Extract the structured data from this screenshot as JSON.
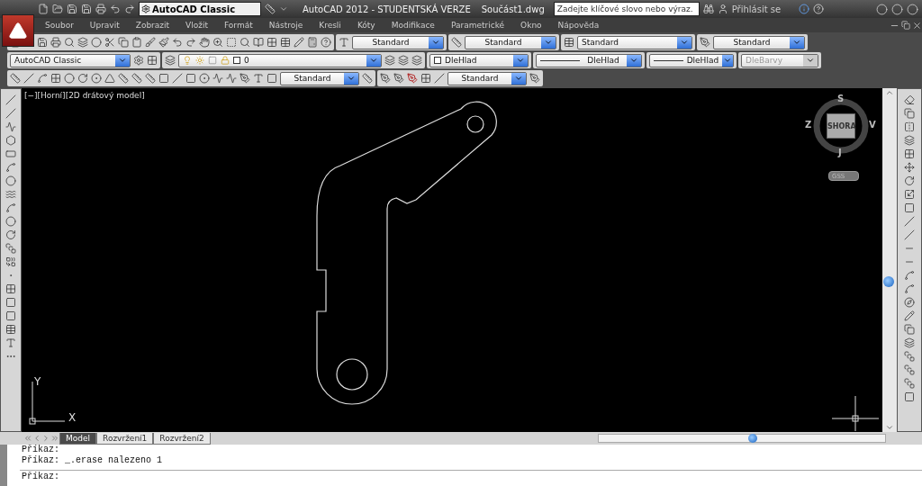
{
  "title_bar": {
    "workspace": "AutoCAD Classic",
    "title": "AutoCAD 2012 - STUDENTSKÁ VERZE",
    "file": "Součást1.dwg",
    "search": {
      "placeholder": "Zadejte klíčové slovo nebo výraz."
    },
    "sign_in": "Přihlásit se"
  },
  "menu": [
    "Soubor",
    "Upravit",
    "Zobrazit",
    "Vložit",
    "Formát",
    "Nástroje",
    "Kresli",
    "Kóty",
    "Modifikace",
    "Parametrické",
    "Okno",
    "Nápověda"
  ],
  "styles_toolbar": [
    {
      "value": "Standard"
    },
    {
      "value": "Standard"
    },
    {
      "value": "Standard"
    },
    {
      "value": "Standard"
    }
  ],
  "properties_toolbar": {
    "workspace": "AutoCAD Classic",
    "layer": "0",
    "color_setting": "DleHlad",
    "linetype": "DleHlad",
    "lineweight": "DleHlad",
    "plot_style": {
      "value": "DleBarvy",
      "disabled": true
    }
  },
  "dimension_toolbar": {
    "dim_style": "Standard",
    "multileader_style": "Standard"
  },
  "viewport": {
    "controls": [
      "[−]",
      "[Horní]",
      "[2D drátový model]"
    ]
  },
  "view_cube": {
    "top": "SHORA",
    "north": "S",
    "east": "V",
    "south": "J",
    "west": "Z",
    "ucs_menu": "GSS"
  },
  "ucs": {
    "x": "X",
    "y": "Y"
  },
  "layout_tabs": [
    {
      "label": "Model",
      "selected": true
    },
    {
      "label": "Rozvržení1",
      "selected": false
    },
    {
      "label": "Rozvržení2",
      "selected": false
    }
  ],
  "command_line": {
    "history": [
      "Příkaz:",
      "Příkaz: _.erase nalezeno 1"
    ],
    "prompt": "Příkaz:"
  }
}
